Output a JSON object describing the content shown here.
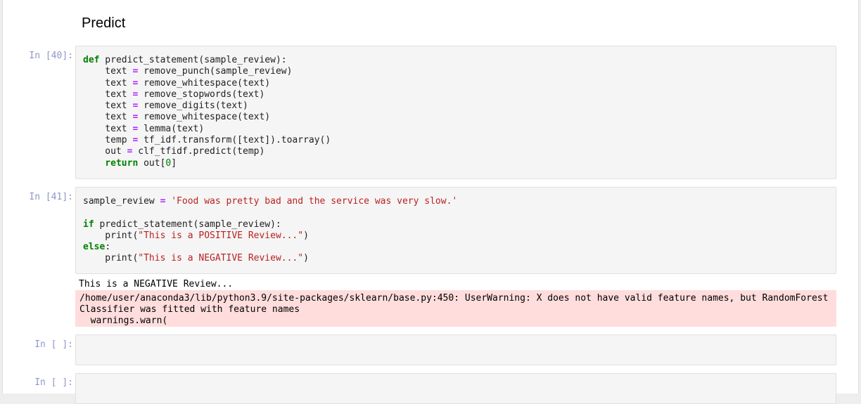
{
  "section_heading": "Predict",
  "cells": [
    {
      "prompt": "In [40]:",
      "lines": [
        "def predict_statement(sample_review):",
        "    text = remove_punch(sample_review)",
        "    text = remove_whitespace(text)",
        "    text = remove_stopwords(text)",
        "    text = remove_digits(text)",
        "    text = remove_whitespace(text)",
        "    text = lemma(text)",
        "    temp = tf_idf.transform([text]).toarray()",
        "    out = clf_tfidf.predict(temp)",
        "    return out[0]"
      ]
    },
    {
      "prompt": "In [41]:",
      "lines": [
        "sample_review = 'Food was pretty bad and the service was very slow.'",
        "",
        "if predict_statement(sample_review):",
        "    print(\"This is a POSITIVE Review...\")",
        "else:",
        "    print(\"This is a NEGATIVE Review...\")"
      ],
      "stdout": "This is a NEGATIVE Review...",
      "stderr": "/home/user/anaconda3/lib/python3.9/site-packages/sklearn/base.py:450: UserWarning: X does not have valid feature names, but RandomForestClassifier was fitted with feature names\n  warnings.warn("
    },
    {
      "prompt": "In [ ]:",
      "lines": []
    },
    {
      "prompt": "In [ ]:",
      "lines": []
    }
  ],
  "colors": {
    "keyword": "#008000",
    "operator": "#aa22ff",
    "string": "#ba2121",
    "stderr_bg": "#ffdddd",
    "prompt": "#303f9f"
  }
}
